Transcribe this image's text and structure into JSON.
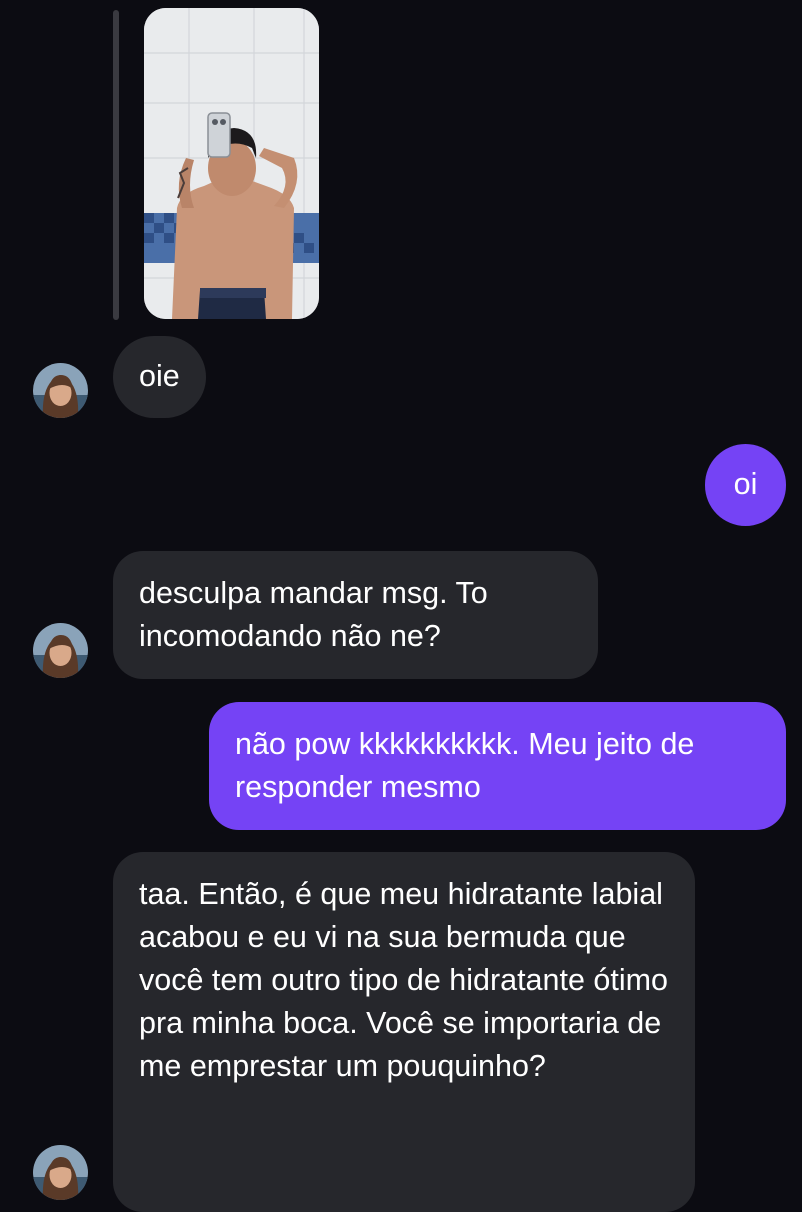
{
  "conversation": {
    "shared_photo": {
      "description_icon": "mirror-selfie-photo"
    },
    "messages": [
      {
        "id": "m1",
        "sender": "them",
        "text": "oie"
      },
      {
        "id": "m2",
        "sender": "me",
        "text": "oi"
      },
      {
        "id": "m3",
        "sender": "them",
        "text": "desculpa mandar msg. To incomodando não ne?"
      },
      {
        "id": "m4",
        "sender": "me",
        "text": "não pow kkkkkkkkkk. Meu jeito de responder mesmo"
      },
      {
        "id": "m5",
        "sender": "them",
        "text": "taa. Então, é que meu hidratante labial acabou e eu vi na sua bermuda que você tem outro tipo de hidratante ótimo pra minha boca. Você se importaria de me emprestar um pouquinho?"
      }
    ]
  },
  "colors": {
    "background": "#0c0c12",
    "incoming_bubble": "#26272c",
    "outgoing_bubble": "#7543f5",
    "text": "#ffffff"
  }
}
